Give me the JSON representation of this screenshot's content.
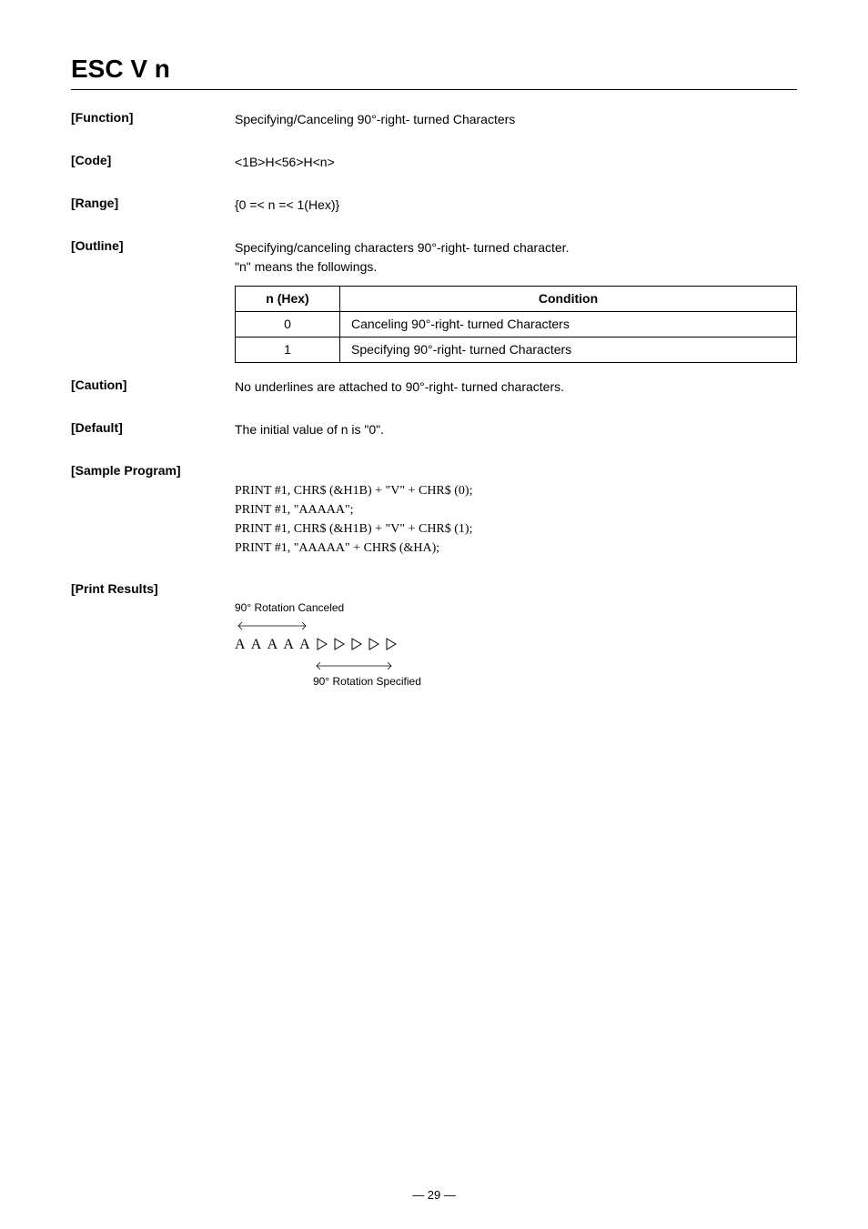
{
  "title": "ESC V n",
  "function": {
    "label": "[Function]",
    "value": "Specifying/Canceling 90°-right- turned Characters"
  },
  "code": {
    "label": "[Code]",
    "value": "<1B>H<56>H<n>"
  },
  "range": {
    "label": "[Range]",
    "value": "{0 =< n =< 1(Hex)}"
  },
  "outline": {
    "label": "[Outline]",
    "value": "Specifying/canceling characters 90°-right- turned character.\n\"n\" means the followings.",
    "table": {
      "headers": {
        "n": "n (Hex)",
        "cond": "Condition"
      },
      "rows": [
        {
          "n": "0",
          "cond": "Canceling 90°-right- turned Characters"
        },
        {
          "n": "1",
          "cond": "Specifying 90°-right- turned Characters"
        }
      ]
    }
  },
  "caution": {
    "label": "[Caution]",
    "value": "No underlines are attached to 90°-right- turned characters."
  },
  "default": {
    "label": "[Default]",
    "value": "The initial value of n is \"0\"."
  },
  "sample": {
    "label": "[Sample Program]",
    "lines": [
      "PRINT #1, CHR$ (&H1B) + \"V\" + CHR$ (0);",
      "PRINT #1, \"AAAAA\";",
      "PRINT #1, CHR$ (&H1B) + \"V\" + CHR$ (1);",
      "PRINT #1, \"AAAAA\" + CHR$ (&HA);"
    ]
  },
  "results": {
    "label": "[Print Results]",
    "canceled_note": "90° Rotation Canceled",
    "as": "A A A A A",
    "specified_note": "90° Rotation Specified"
  },
  "footer": "— 29 —"
}
